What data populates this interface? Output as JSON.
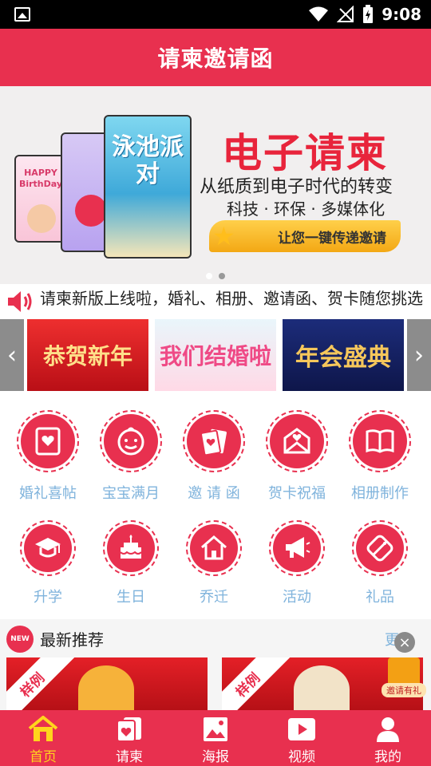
{
  "status_bar": {
    "time": "9:08"
  },
  "header": {
    "title": "请柬邀请函"
  },
  "banner": {
    "title": "电子请柬",
    "subtitle": "从纸质到电子时代的转变",
    "features": "科技 · 环保 · 多媒体化",
    "cta": "让您一键传递邀请",
    "phone_texts": [
      "HAPPY BirthDay",
      "泳池派对"
    ],
    "slide_count": 2,
    "active_slide": 2
  },
  "notice": {
    "text": "请柬新版上线啦，婚礼、相册、邀请函、贺卡随您挑选"
  },
  "strip": {
    "templates": [
      "恭贺新年",
      "我们结婚啦",
      "年会盛典"
    ]
  },
  "categories": [
    {
      "label": "婚礼喜帖",
      "icon": "wedding-card-icon"
    },
    {
      "label": "宝宝满月",
      "icon": "baby-face-icon"
    },
    {
      "label": "邀 请 函",
      "icon": "invitation-cards-icon"
    },
    {
      "label": "贺卡祝福",
      "icon": "envelope-heart-icon"
    },
    {
      "label": "相册制作",
      "icon": "photo-album-icon"
    },
    {
      "label": "升学",
      "icon": "graduation-cap-icon"
    },
    {
      "label": "生日",
      "icon": "birthday-cake-icon"
    },
    {
      "label": "乔迁",
      "icon": "house-icon"
    },
    {
      "label": "活动",
      "icon": "megaphone-icon"
    },
    {
      "label": "礼品",
      "icon": "gift-tag-icon"
    }
  ],
  "recommend": {
    "badge": "NEW",
    "title": "最新推荐",
    "more": "更多",
    "cards": [
      {
        "ribbon": "样例"
      },
      {
        "ribbon": "样例"
      }
    ],
    "float_label": "邀请有礼"
  },
  "bottom_nav": [
    {
      "label": "首页",
      "icon": "home-icon",
      "active": true
    },
    {
      "label": "请柬",
      "icon": "invitation-icon",
      "active": false
    },
    {
      "label": "海报",
      "icon": "poster-icon",
      "active": false
    },
    {
      "label": "视频",
      "icon": "video-play-icon",
      "active": false
    },
    {
      "label": "我的",
      "icon": "user-icon",
      "active": false
    }
  ],
  "colors": {
    "primary": "#e8304f",
    "label_blue": "#7fb3dc",
    "active_nav": "#ffd51c"
  }
}
